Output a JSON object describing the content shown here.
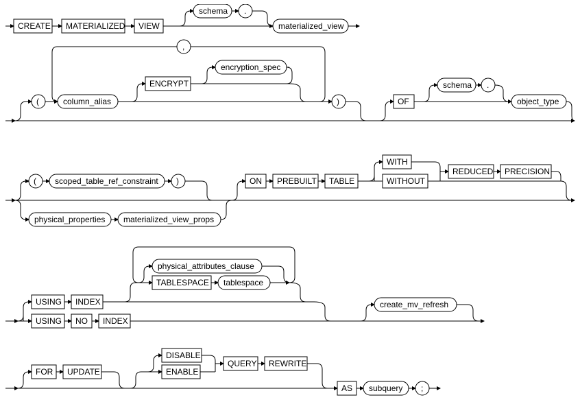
{
  "diagram_name": "create_materialized_view",
  "r1": {
    "create": "CREATE",
    "materialized": "MATERIALIZED",
    "view": "VIEW",
    "schema": "schema",
    "dot": ".",
    "mv": "materialized_view"
  },
  "r2": {
    "lp": "(",
    "col_alias": "column_alias",
    "encrypt": "ENCRYPT",
    "enc_spec": "encryption_spec",
    "comma": ",",
    "rp": ")",
    "of": "OF",
    "schema": "schema",
    "dot": ".",
    "obj_type": "object_type"
  },
  "r3": {
    "lp": "(",
    "scoped": "scoped_table_ref_constraint",
    "rp": ")",
    "phys": "physical_properties",
    "mv_props": "materialized_view_props",
    "on": "ON",
    "prebuilt": "PREBUILT",
    "table": "TABLE",
    "with": "WITH",
    "without": "WITHOUT",
    "reduced": "REDUCED",
    "precision": "PRECISION"
  },
  "r4": {
    "using1": "USING",
    "index": "INDEX",
    "pac": "physical_attributes_clause",
    "tablespace": "TABLESPACE",
    "ts": "tablespace",
    "using2": "USING",
    "no": "NO",
    "index2": "INDEX",
    "refresh": "create_mv_refresh"
  },
  "r5": {
    "for": "FOR",
    "update": "UPDATE",
    "disable": "DISABLE",
    "enable": "ENABLE",
    "query": "QUERY",
    "rewrite": "REWRITE",
    "as": "AS",
    "subquery": "subquery",
    "semi": ";"
  }
}
